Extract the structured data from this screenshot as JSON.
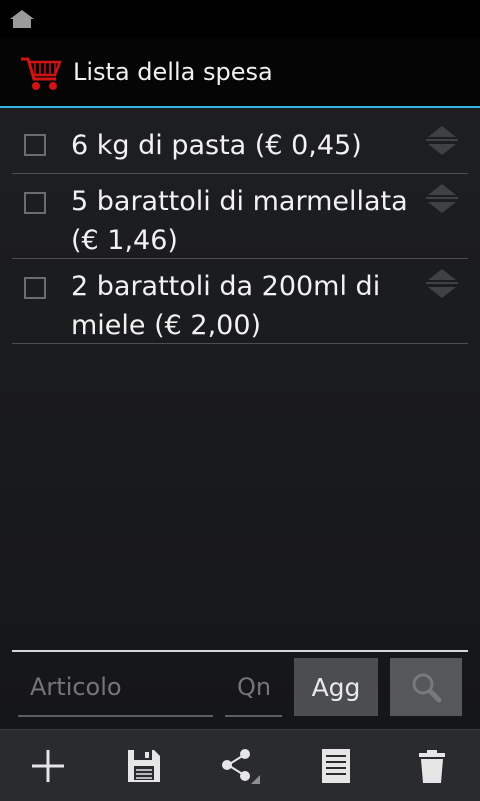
{
  "app": {
    "title": "Lista della spesa",
    "accent_color": "#33b5e5",
    "app_icon": "shopping-cart-icon",
    "home_icon": "home-icon"
  },
  "items": [
    {
      "text": "6 kg di pasta (€ 0,45)",
      "checked": false
    },
    {
      "text": "5 barattoli di marmellata (€ 1,46)",
      "checked": false
    },
    {
      "text": "2 barattoli da 200ml di miele (€ 2,00)",
      "checked": false
    }
  ],
  "input": {
    "article_placeholder": "Articolo",
    "quantity_placeholder": "Qn",
    "add_label": "Agg",
    "search_icon": "search-icon"
  },
  "bottom_bar": {
    "icons": [
      "add-icon",
      "save-icon",
      "share-icon",
      "list-icon",
      "delete-icon"
    ]
  }
}
